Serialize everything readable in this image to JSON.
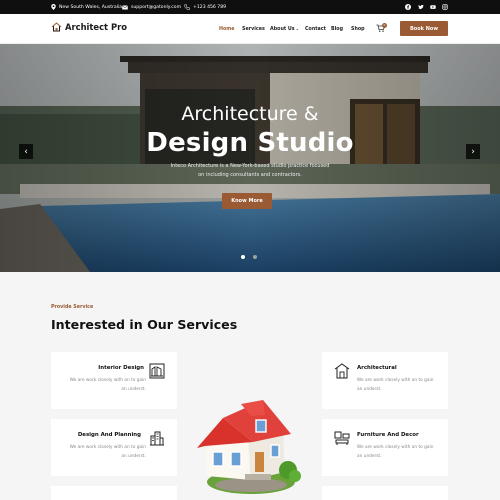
{
  "topbar": {
    "location": "New South Wales, Australia",
    "email": "support@gatonly.com",
    "phone": "+123 456 789",
    "social": [
      "facebook-icon",
      "twitter-icon",
      "youtube-icon",
      "instagram-icon"
    ]
  },
  "header": {
    "logo": "Architect Pro",
    "nav": [
      "Home",
      "Services",
      "About Us",
      "Contact",
      "Blog",
      "Shop"
    ],
    "about_caret": "⌄",
    "cart_count": "0",
    "cta": "Book Now"
  },
  "hero": {
    "title_line1": "Architecture &",
    "title_line2": "Design Studio",
    "subtitle": "Inteco Architecture is a New-York-based studio practice focused on including consultants and contractors.",
    "button": "Know More",
    "prev": "‹",
    "next": "›"
  },
  "services": {
    "eyebrow": "Provide Service",
    "title": "Interested in Our Services",
    "cards": [
      {
        "title": "Interior Design",
        "desc": "We are work closely with an to gain an underst.",
        "icon": "interior-design-icon"
      },
      {
        "title": "Design And Planning",
        "desc": "We are work closely with an to gain an underst.",
        "icon": "buildings-icon"
      },
      {
        "title": "Architectural",
        "desc": "We are work closely with an to gain an underst.",
        "icon": "architecture-icon"
      },
      {
        "title": "Furniture And Decor",
        "desc": "We are work closely with an to gain an underst.",
        "icon": "furniture-icon"
      }
    ]
  },
  "colors": {
    "accent": "#9a5a33",
    "dark": "#0f0f0f",
    "bg": "#f5f5f5"
  }
}
